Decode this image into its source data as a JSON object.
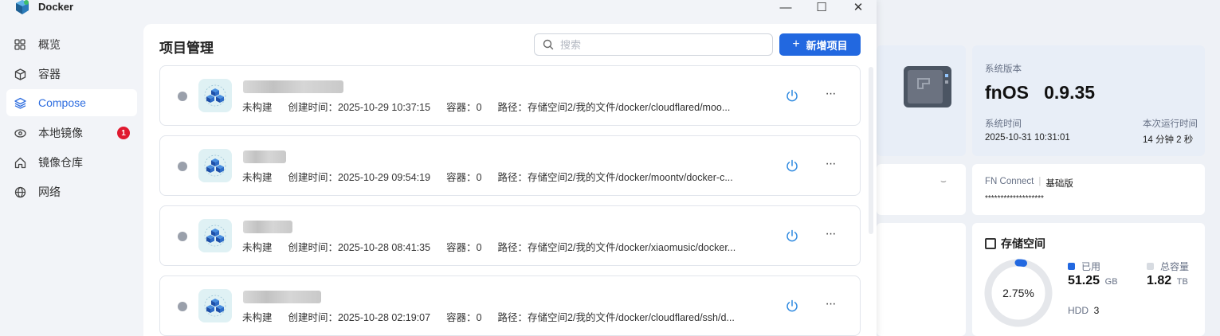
{
  "window": {
    "title": "Docker",
    "controls": {
      "minimize": "—",
      "maximize": "☐",
      "close": "✕"
    }
  },
  "sidebar": {
    "items": [
      {
        "label": "概览",
        "icon": "grid-icon"
      },
      {
        "label": "容器",
        "icon": "cube-icon"
      },
      {
        "label": "Compose",
        "icon": "layers-icon",
        "active": true
      },
      {
        "label": "本地镜像",
        "icon": "eye-disc-icon",
        "badge": "1"
      },
      {
        "label": "镜像仓库",
        "icon": "home-icon"
      },
      {
        "label": "网络",
        "icon": "globe-icon"
      }
    ]
  },
  "main": {
    "title": "项目管理",
    "search": {
      "placeholder": "搜索",
      "value": ""
    },
    "add_button": "新增项目",
    "projects": [
      {
        "status": "未构建",
        "created": "创建时间：2025-10-29 10:37:15",
        "containers": "容器：0",
        "path": "路径：存储空间2/我的文件/docker/cloudflared/moo..."
      },
      {
        "status": "未构建",
        "created": "创建时间：2025-10-29 09:54:19",
        "containers": "容器：0",
        "path": "路径：存储空间2/我的文件/docker/moontv/docker-c..."
      },
      {
        "status": "未构建",
        "created": "创建时间：2025-10-28 08:41:35",
        "containers": "容器：0",
        "path": "路径：存储空间2/我的文件/docker/xiaomusic/docker..."
      },
      {
        "status": "未构建",
        "created": "创建时间：2025-10-28 02:19:07",
        "containers": "容器：0",
        "path": "路径：存储空间2/我的文件/docker/cloudflared/ssh/d..."
      }
    ]
  },
  "dashboard": {
    "system_version_label": "系统版本",
    "system_version": "fnOS   0.9.35",
    "system_time_label": "系统时间",
    "system_time": "2025-10-31 10:31:01",
    "uptime_label": "本次运行时间",
    "uptime": "14 分钟 2 秒",
    "fn_connect_label": "FN Connect",
    "fn_connect_plan": "基础版",
    "fn_connect_masked": "*******************",
    "storage_title": "存储空间",
    "storage_percent": "2.75%",
    "storage_fraction": 0.0275,
    "used_label": "已用",
    "used_value": "51.25",
    "used_unit": "GB",
    "total_label": "总容量",
    "total_value": "1.82",
    "total_unit": "TB",
    "disk_type": "HDD",
    "disk_count": "3"
  },
  "colors": {
    "accent": "#2268e0",
    "badge": "#e0192f",
    "status_idle": "#9aa0ab"
  }
}
